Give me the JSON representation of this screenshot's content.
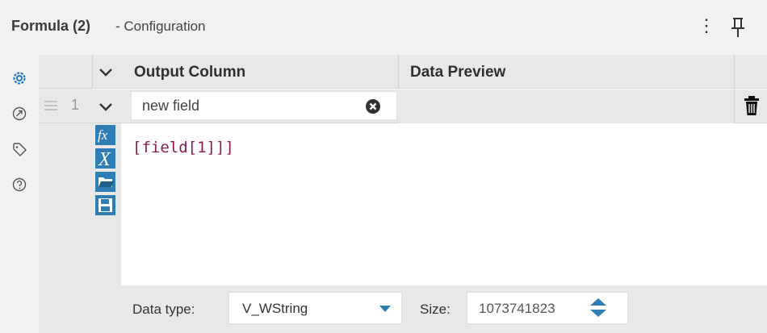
{
  "header": {
    "title": "Formula (2)",
    "subtitle": "- Configuration",
    "menu_icon": "kebab-menu-icon",
    "pin_icon": "pin-icon"
  },
  "rail": {
    "icons": [
      "gear-icon",
      "annotation-icon",
      "tag-icon",
      "help-icon"
    ],
    "active_color": "#1f77c9"
  },
  "grid": {
    "columns": [
      "Output Column",
      "Data Preview"
    ],
    "rows": [
      {
        "number": "1",
        "output_column": "new field",
        "data_preview": ""
      }
    ]
  },
  "expression": {
    "text": "[field[1]]]",
    "tools": [
      "function-icon",
      "variable-icon",
      "open-folder-icon",
      "save-icon"
    ]
  },
  "bottom": {
    "data_type_label": "Data type:",
    "data_type_value": "V_WString",
    "size_label": "Size:",
    "size_value": "1073741823"
  },
  "colors": {
    "accent": "#2e7db5",
    "code": "#8b1a55",
    "panel": "#e8e8e8"
  }
}
